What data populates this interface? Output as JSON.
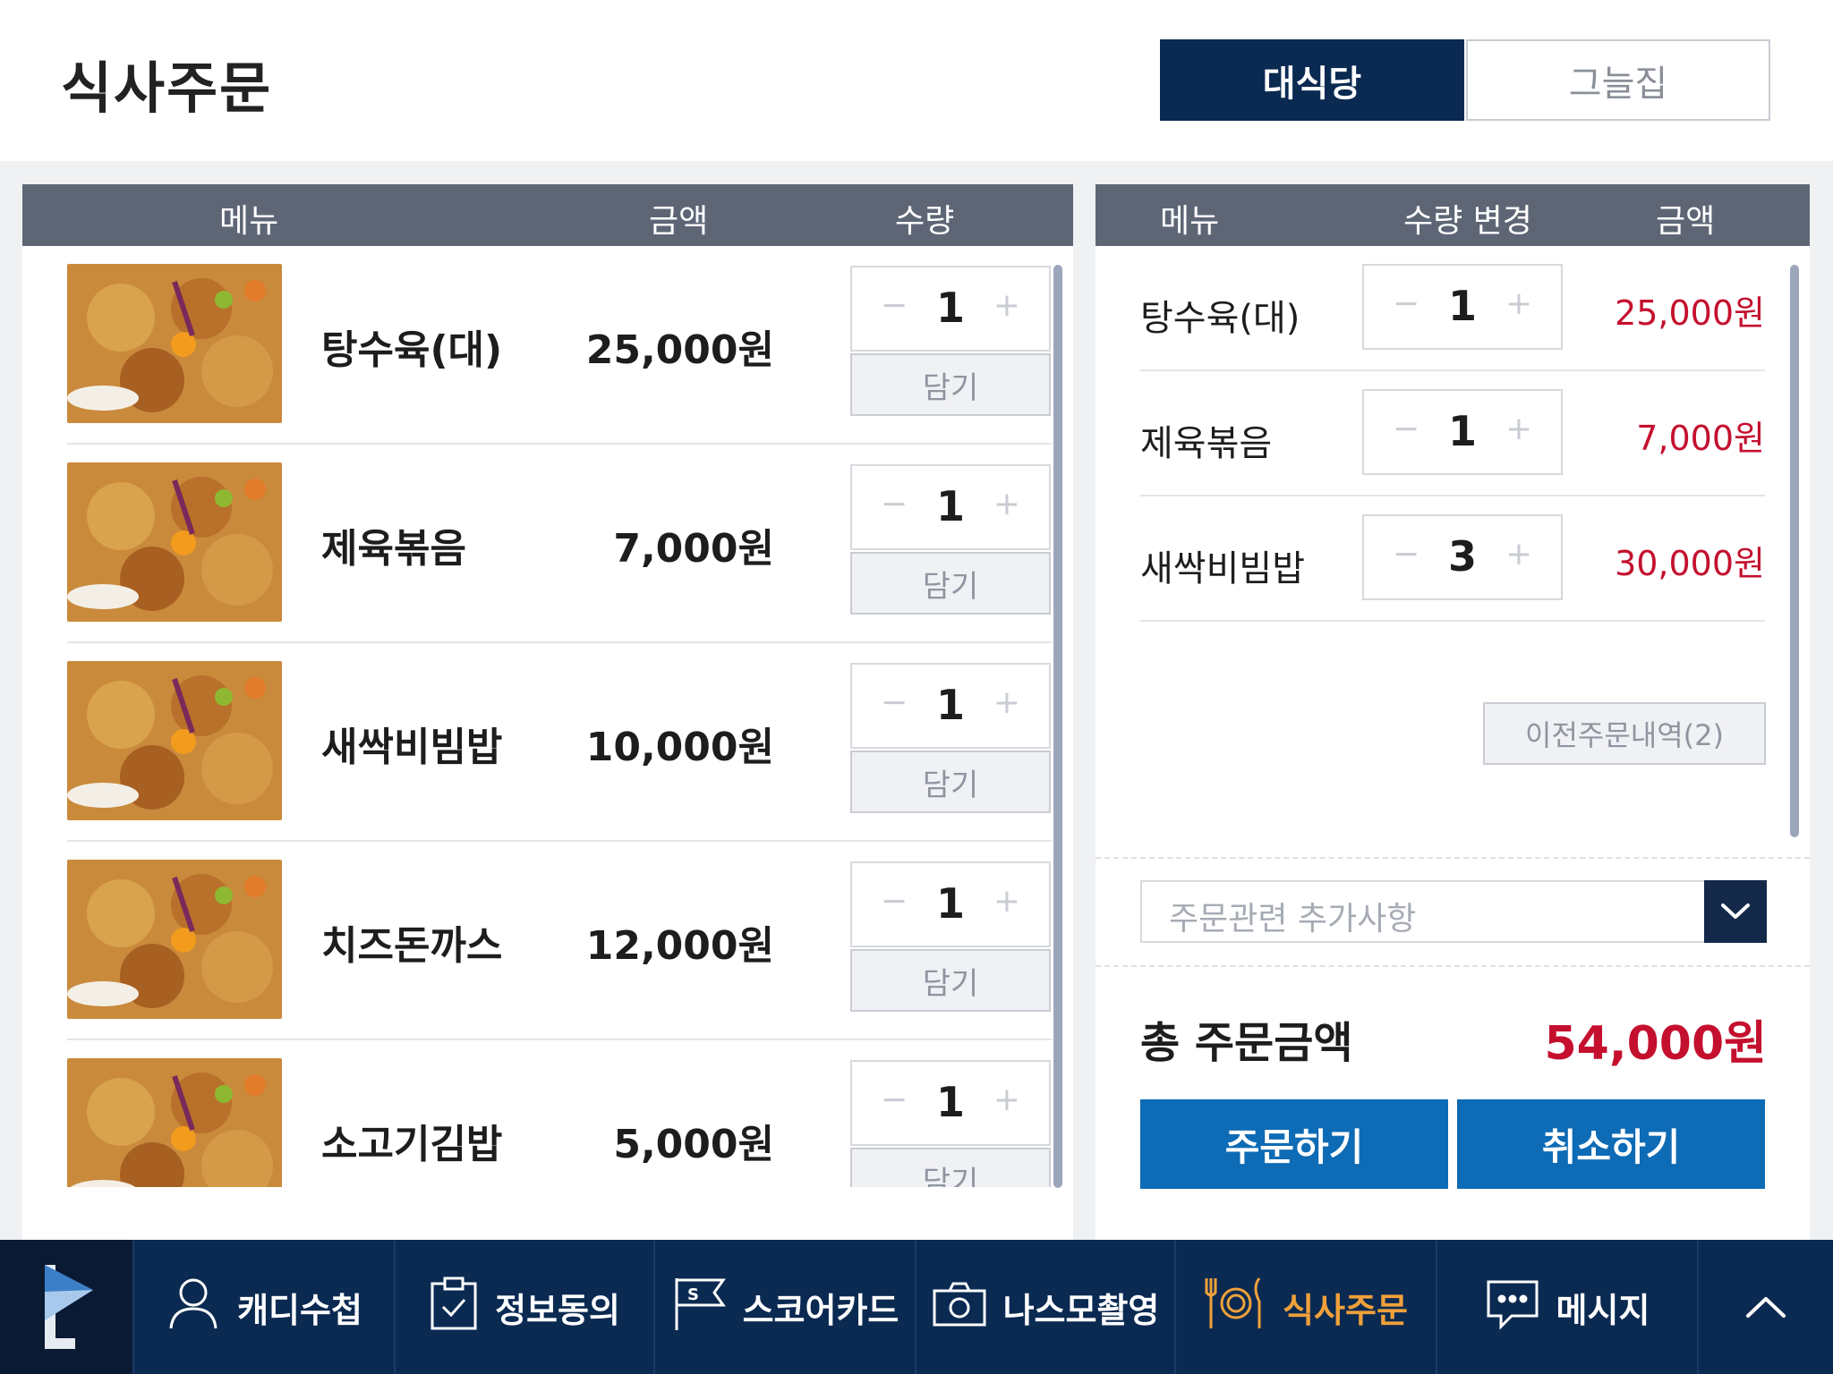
{
  "header": {
    "title": "식사주문",
    "toggle": {
      "active_label": "대식당",
      "inactive_label": "그늘집"
    }
  },
  "menu_table": {
    "headers": {
      "menu": "메뉴",
      "price": "금액",
      "qty": "수량"
    },
    "add_label": "담기",
    "minus_symbol": "−",
    "plus_symbol": "+",
    "items": [
      {
        "name": "탕수육(대)",
        "price": "25,000원",
        "qty": "1"
      },
      {
        "name": "제육볶음",
        "price": "7,000원",
        "qty": "1"
      },
      {
        "name": "새싹비빔밥",
        "price": "10,000원",
        "qty": "1"
      },
      {
        "name": "치즈돈까스",
        "price": "12,000원",
        "qty": "1"
      },
      {
        "name": "소고기김밥",
        "price": "5,000원",
        "qty": "1"
      }
    ]
  },
  "order_table": {
    "headers": {
      "menu": "메뉴",
      "qty_change": "수량 변경",
      "amount": "금액"
    },
    "items": [
      {
        "name": "탕수육(대)",
        "qty": "1",
        "amount": "25,000원"
      },
      {
        "name": "제육볶음",
        "qty": "1",
        "amount": "7,000원"
      },
      {
        "name": "새싹비빔밥",
        "qty": "3",
        "amount": "30,000원"
      }
    ],
    "previous_orders_label": "이전주문내역(2)",
    "note_placeholder": "주문관련 추가사항",
    "total_label": "총 주문금액",
    "total_value": "54,000원",
    "order_button": "주문하기",
    "cancel_button": "취소하기"
  },
  "nav": {
    "items": [
      {
        "label": "캐디수첩",
        "icon": "person-icon"
      },
      {
        "label": "정보동의",
        "icon": "clipboard-check-icon"
      },
      {
        "label": "스코어카드",
        "icon": "score-flag-icon"
      },
      {
        "label": "나스모촬영",
        "icon": "camera-icon"
      },
      {
        "label": "식사주문",
        "icon": "dining-icon"
      },
      {
        "label": "메시지",
        "icon": "message-icon"
      }
    ],
    "active": "식사주문"
  },
  "colors": {
    "navy": "#0b2a52",
    "accent_blue": "#0e6bb5",
    "price_red": "#c4102e",
    "active_nav": "#f0a13a"
  }
}
